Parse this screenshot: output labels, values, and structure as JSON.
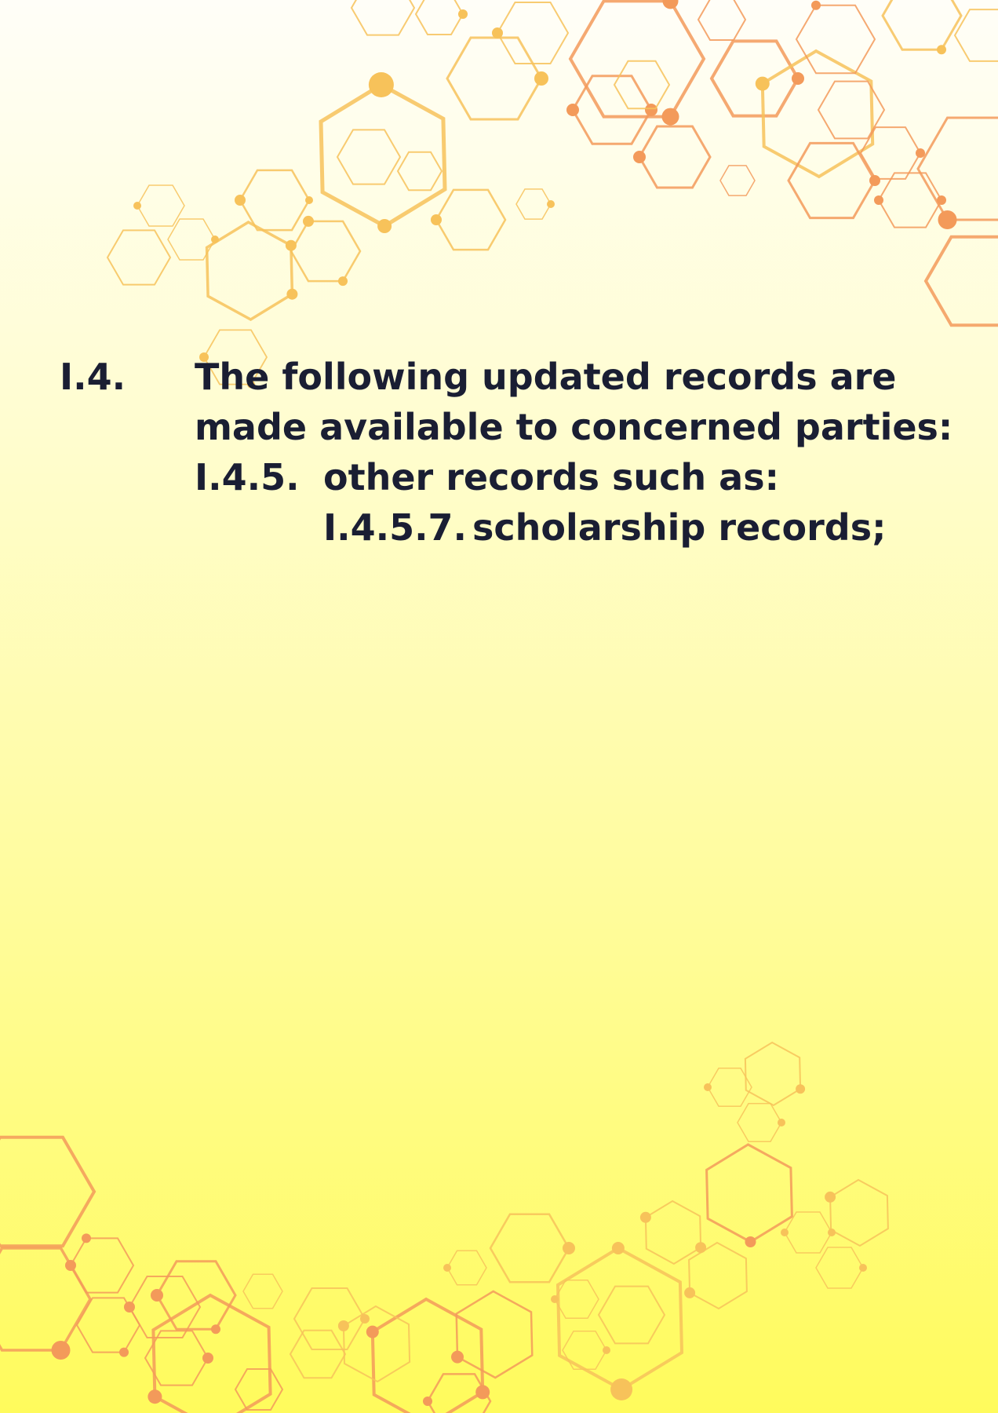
{
  "section": {
    "number": "I.4.",
    "line1": "The following updated records are",
    "line2": "made available to concerned parties:",
    "subsection": {
      "number": "I.4.5.",
      "text": "other records such as:",
      "item": {
        "number": "I.4.5.7.",
        "text": "scholarship records;"
      }
    }
  },
  "colors": {
    "text": "#1a1e33",
    "hex_gold": "#f7c25a",
    "hex_orange": "#f39a5a"
  }
}
